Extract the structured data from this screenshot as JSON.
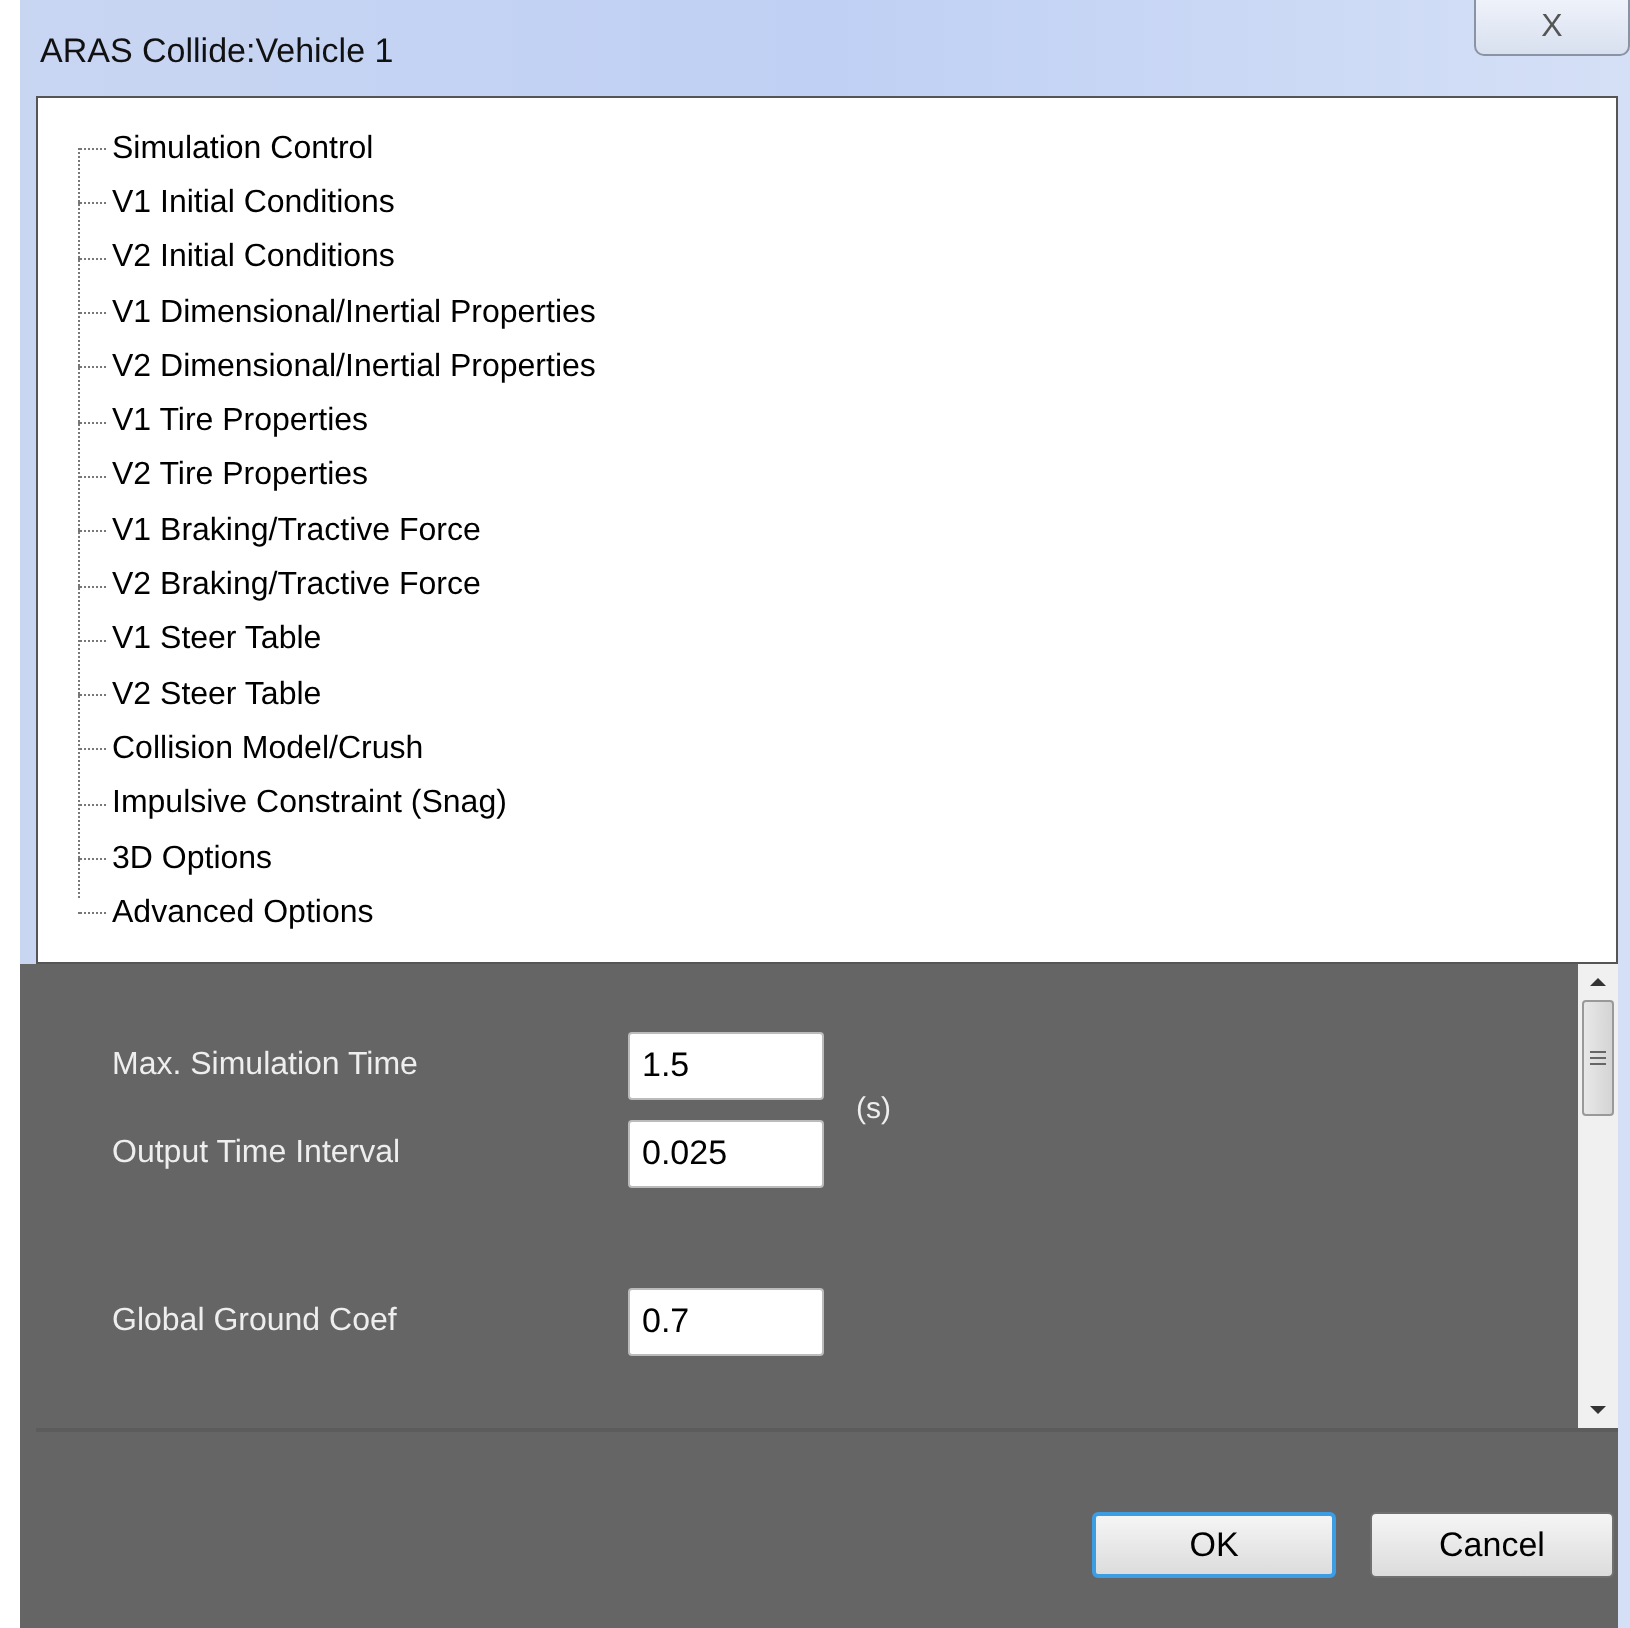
{
  "window": {
    "title": "ARAS Collide:Vehicle 1",
    "close_glyph": "X"
  },
  "tree": {
    "items": [
      {
        "label": "Simulation Control"
      },
      {
        "label": "V1 Initial Conditions"
      },
      {
        "label": "V2 Initial Conditions"
      },
      {
        "label": "V1 Dimensional/Inertial Properties"
      },
      {
        "label": "V2 Dimensional/Inertial Properties"
      },
      {
        "label": "V1 Tire Properties"
      },
      {
        "label": "V2 Tire Properties"
      },
      {
        "label": "V1 Braking/Tractive Force"
      },
      {
        "label": "V2 Braking/Tractive Force"
      },
      {
        "label": "V1 Steer Table"
      },
      {
        "label": "V2 Steer Table"
      },
      {
        "label": "Collision Model/Crush"
      },
      {
        "label": "Impulsive Constraint (Snag)"
      },
      {
        "label": "3D Options"
      },
      {
        "label": "Advanced Options"
      }
    ]
  },
  "form": {
    "fields": [
      {
        "label": "Max. Simulation Time",
        "value": "1.5"
      },
      {
        "label": "Output Time Interval",
        "value": "0.025"
      },
      {
        "label": "Global Ground Coef",
        "value": "0.7"
      }
    ],
    "unit": "(s)"
  },
  "buttons": [
    {
      "label": "OK",
      "default": true
    },
    {
      "label": "Cancel",
      "default": false
    }
  ]
}
